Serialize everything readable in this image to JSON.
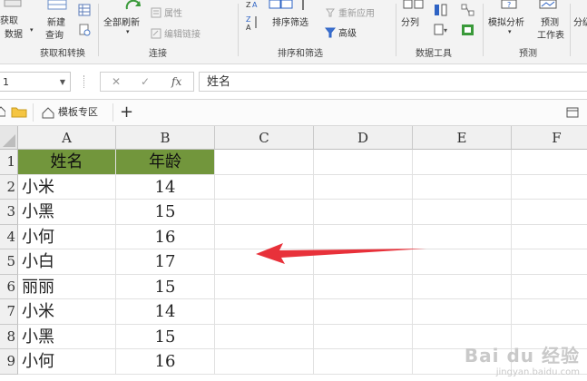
{
  "ribbon": {
    "get_data_label_line1": "获取",
    "get_data_label_line2": "数据",
    "new_query_line1": "新建",
    "new_query_line2": "查询",
    "group_get_transform": "获取和转换",
    "refresh_all": "全部刷新",
    "properties": "属性",
    "edit_links": "编辑链接",
    "group_connections": "连接",
    "sort": "排序",
    "filter": "筛选",
    "reapply": "重新应用",
    "advanced": "高级",
    "group_sort_filter": "排序和筛选",
    "split": "分列",
    "group_data_tools": "数据工具",
    "whatif": "模拟分析",
    "forecast_line1": "预测",
    "forecast_line2": "工作表",
    "group_forecast": "预测",
    "outline": "分级"
  },
  "formula_bar": {
    "name_box": "1",
    "cancel_symbol": "✕",
    "enter_symbol": "✓",
    "fx_symbol": "fx",
    "content": "姓名"
  },
  "tabs": {
    "template_zone": "模板专区",
    "add": "+"
  },
  "columns": [
    "A",
    "B",
    "C",
    "D",
    "E",
    "F"
  ],
  "rows": [
    "1",
    "2",
    "3",
    "4",
    "5",
    "6",
    "7",
    "8",
    "9"
  ],
  "table": {
    "headers": [
      "姓名",
      "年龄"
    ],
    "rows": [
      [
        "小米",
        "14"
      ],
      [
        "小黑",
        "15"
      ],
      [
        "小何",
        "16"
      ],
      [
        "小白",
        "17"
      ],
      [
        "丽丽",
        "15"
      ],
      [
        "小米",
        "14"
      ],
      [
        "小黑",
        "15"
      ],
      [
        "小何",
        "16"
      ]
    ],
    "header_fill": "#72963c"
  },
  "annotation": {
    "arrow_color": "#e8313a"
  },
  "watermark": {
    "brand": "Bai du 经验",
    "url": "jingyan.baidu.com"
  }
}
